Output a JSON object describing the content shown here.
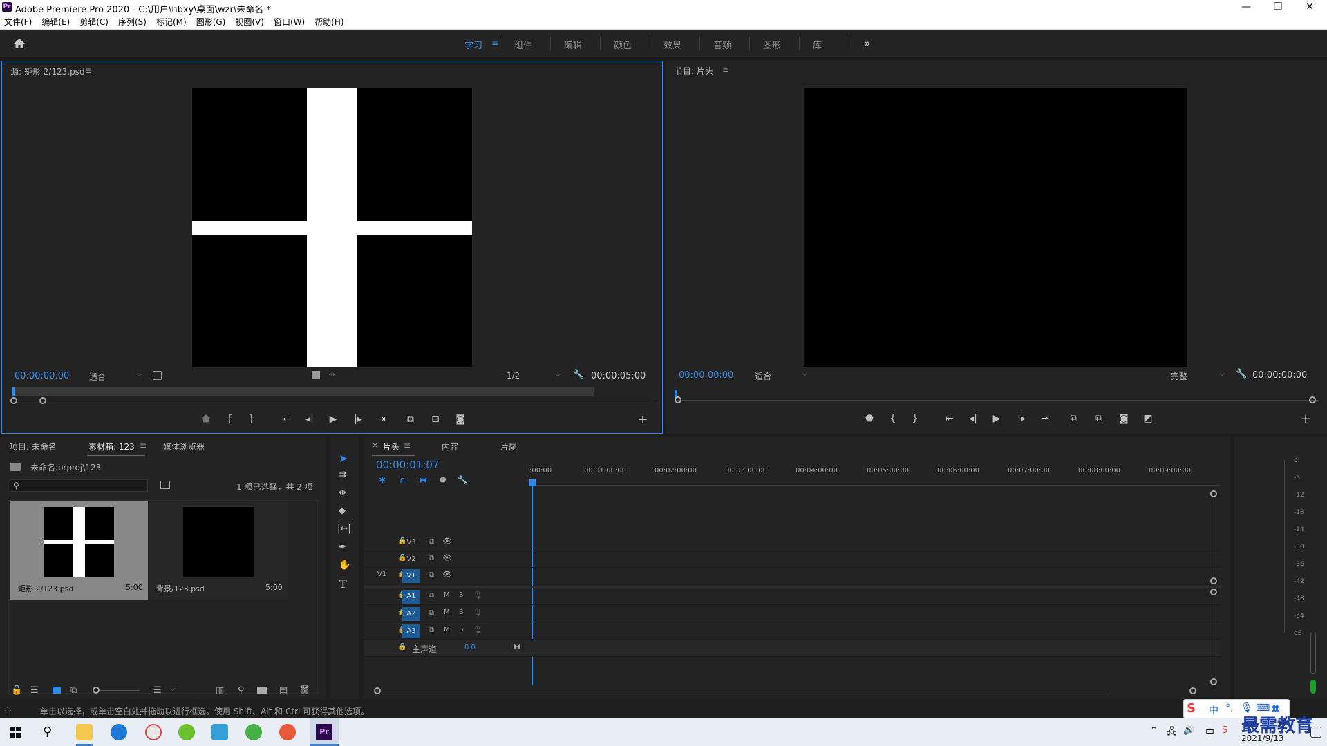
{
  "window": {
    "title": "Adobe Premiere Pro 2020 - C:\\用户\\hbxy\\桌面\\wzr\\未命名 *",
    "logo": "Pr"
  },
  "menu": [
    "文件(F)",
    "编辑(E)",
    "剪辑(C)",
    "序列(S)",
    "标记(M)",
    "图形(G)",
    "视图(V)",
    "窗口(W)",
    "帮助(H)"
  ],
  "workspaces": {
    "tabs": [
      "学习",
      "组件",
      "编辑",
      "颜色",
      "效果",
      "音频",
      "图形",
      "库"
    ],
    "active": "学习",
    "overflow": "»"
  },
  "source": {
    "title": "源: 矩形 2/123.psd",
    "timecode": "00:00:00:00",
    "zoom": "适合",
    "resolution": "1/2",
    "duration": "00:00:05:00"
  },
  "program": {
    "title": "节目: 片头",
    "timecode": "00:00:00:00",
    "zoom": "适合",
    "quality": "完整",
    "duration": "00:00:00:00"
  },
  "project": {
    "tabs": [
      "项目: 未命名",
      "素材箱: 123",
      "媒体浏览器"
    ],
    "active_tab": "素材箱: 123",
    "path": "未命名.prproj\\123",
    "selection": "1 项已选择，共 2 项",
    "items": [
      {
        "name": "矩形 2/123.psd",
        "duration": "5:00",
        "selected": true
      },
      {
        "name": "背景/123.psd",
        "duration": "5:00",
        "selected": false
      }
    ]
  },
  "timeline": {
    "tabs": [
      "片头",
      "内容",
      "片尾"
    ],
    "timecode": "00:00:01:07",
    "ruler": [
      ":00:00",
      "00:01:00:00",
      "00:02:00:00",
      "00:03:00:00",
      "00:04:00:00",
      "00:05:00:00",
      "00:06:00:00",
      "00:07:00:00",
      "00:08:00:00",
      "00:09:00:00"
    ],
    "video_tracks": [
      "V3",
      "V2",
      "V1"
    ],
    "source_patch": "V1",
    "audio_tracks": [
      "A1",
      "A2",
      "A3"
    ],
    "master": {
      "label": "主声道",
      "value": "0.0"
    },
    "mute_label": "M",
    "solo_label": "S"
  },
  "meters": {
    "scale": [
      "0",
      "-6",
      "-12",
      "-18",
      "-24",
      "-30",
      "-36",
      "-42",
      "-48",
      "-54",
      "dB"
    ]
  },
  "status": "单击以选择，或单击空白处并拖动以进行框选。使用 Shift、Alt 和 Ctrl 可获得其他选项。",
  "taskbar": {
    "date": "2021/9/13",
    "ime": "中",
    "watermark": "最需教育"
  }
}
